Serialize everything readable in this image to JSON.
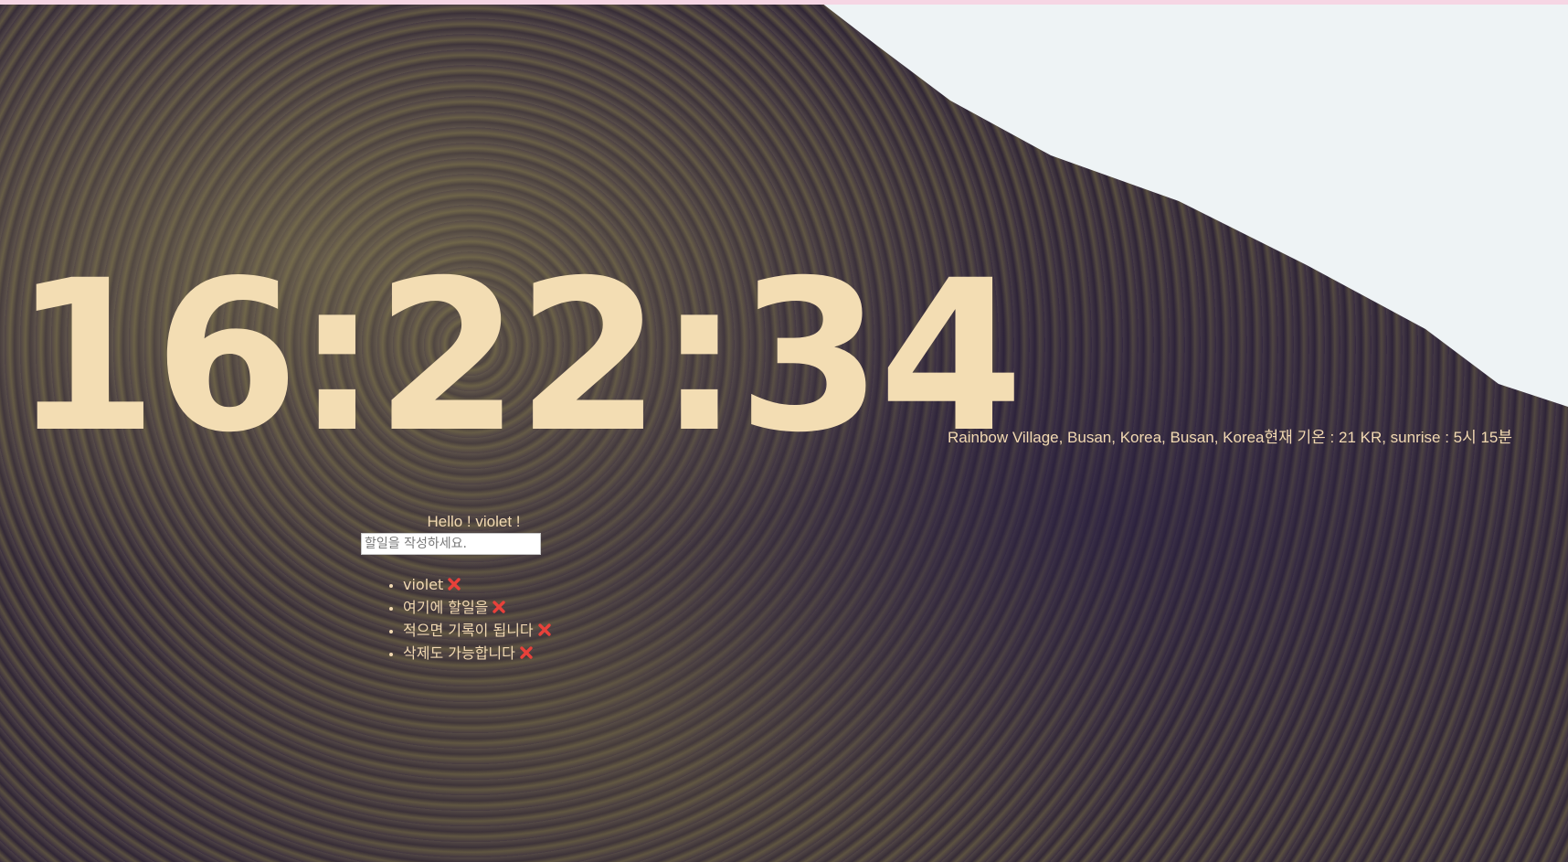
{
  "clock": {
    "time": "16:22:34"
  },
  "weather": {
    "location": "Rainbow Village, Busan, Korea, Busan, Korea",
    "temperature_text": "현재 기온 : 21 KR, sunrise : 5시 15분"
  },
  "greeting": {
    "text": "Hello ! violet !"
  },
  "todo_form": {
    "input_value": "",
    "placeholder": "할일을 작성하세요."
  },
  "todos": [
    {
      "text": "violet",
      "delete_icon": "cross-mark-icon"
    },
    {
      "text": "여기에 할일을",
      "delete_icon": "cross-mark-icon"
    },
    {
      "text": "적으면 기록이 됩니다",
      "delete_icon": "cross-mark-icon"
    },
    {
      "text": "삭제도 가능합니다",
      "delete_icon": "cross-mark-icon"
    }
  ],
  "colors": {
    "text_accent": "#f3ddb3",
    "delete_icon": "#e8413a",
    "sky": "#eef3f5"
  }
}
